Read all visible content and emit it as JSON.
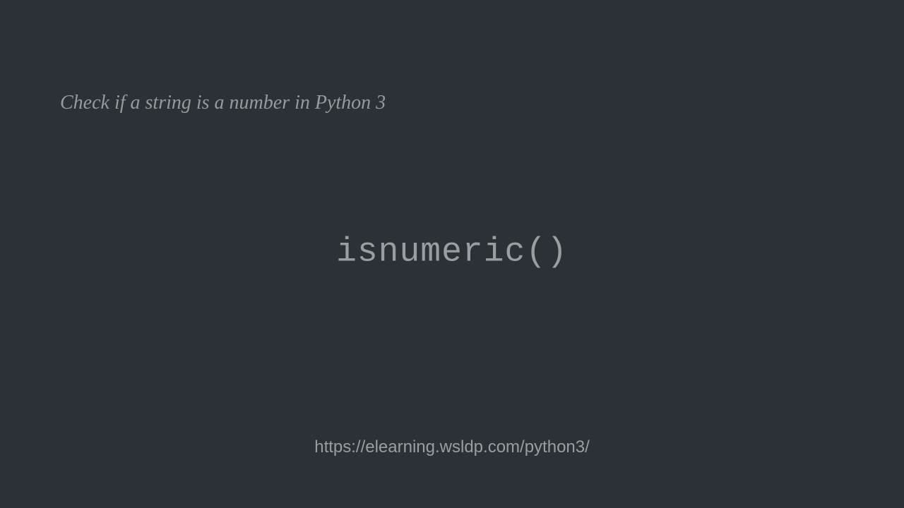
{
  "slide": {
    "title": "Check if a string is a number in Python 3",
    "main_text": "isnumeric()",
    "footer_url": "https://elearning.wsldp.com/python3/"
  }
}
